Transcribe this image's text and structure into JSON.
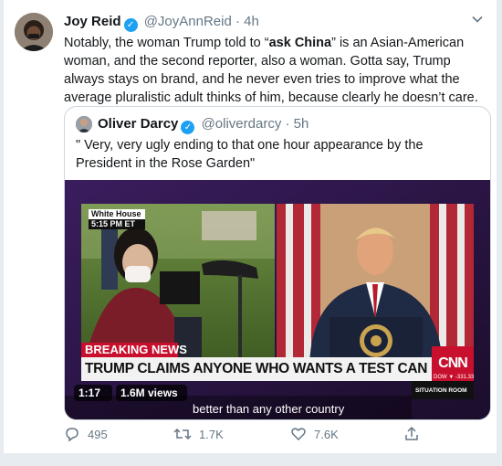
{
  "tweet": {
    "author_name": "Joy Reid",
    "author_handle": "@JoyAnnReid",
    "separator": "·",
    "time": "4h",
    "text_before": "Notably, the woman Trump told to “",
    "text_bold": "ask China",
    "text_after": "” is an Asian-American woman, and the second reporter, also a woman. Gotta say, Trump always stays on brand, and he never even tries to improve what the average pluralistic adult thinks of him, because clearly he doesn’t care.",
    "more_icon": "chevron-down-icon"
  },
  "quoted": {
    "author_name": "Oliver Darcy",
    "author_handle": "@oliverdarcy",
    "separator": "·",
    "time": "5h",
    "text": "\" Very, very ugly ending to that one hour appearance by the President in the Rose Garden\"",
    "media": {
      "location_label": "White House",
      "time_label": "5:15 PM ET",
      "breaking": "BREAKING NEWS",
      "headline": "TRUMP CLAIMS ANYONE WHO WANTS A TEST CAN GET ONE",
      "network": "CNN",
      "ticker": "DOW ▼ -331.33",
      "segment": "SITUATION ROOM",
      "duration": "1:17",
      "views": "1.6M views",
      "caption": "better than any other country"
    }
  },
  "actions": {
    "reply_count": "495",
    "retweet_count": "1.7K",
    "like_count": "7.6K"
  },
  "colors": {
    "accent": "#1da1f2",
    "muted": "#657786",
    "breaking_red": "#c8102e"
  }
}
